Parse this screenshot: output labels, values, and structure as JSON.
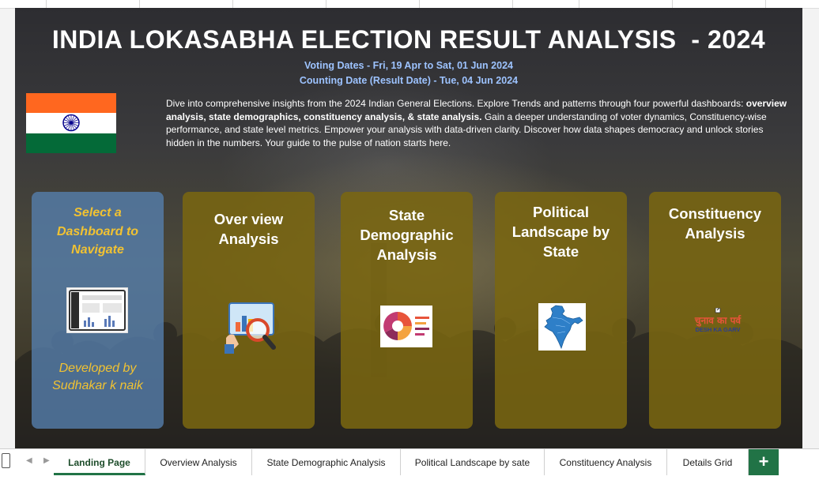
{
  "title": "INDIA LOKASABHA ELECTION RESULT ANALYSIS  - 2024",
  "voting_dates": "Voting Dates - Fri, 19 Apr to Sat, 01 Jun 2024",
  "counting_date": "Counting Date (Result Date) - Tue, 04 Jun 2024",
  "intro": {
    "part1": " Dive into comprehensive insights from the 2024 Indian General Elections. Explore Trends and patterns through four powerful dashboards: ",
    "bold": "overview analysis, state demographics, constituency analysis, & state analysis.",
    "part2": " Gain a deeper understanding of voter dynamics, Constituency-wise performance, and state level metrics. Empower your analysis with data-driven clarity. Discover how data shapes democracy and unlock stories hidden in the numbers. Your guide to the pulse of nation starts here."
  },
  "flag_colors": {
    "saffron": "#ff671f",
    "white": "#ffffff",
    "green": "#046a38",
    "chakra": "#06038d"
  },
  "nav_card": {
    "line1": "Select a",
    "line2": "Dashboard to",
    "line3": "Navigate",
    "dev1": "Developed by",
    "dev2": "Sudhakar k naik"
  },
  "cards": [
    {
      "line1": "Over view",
      "line2": "Analysis",
      "icon": "magnifier-chart-icon"
    },
    {
      "line1": "State",
      "line2": "Demographic",
      "line3": "Analysis",
      "icon": "infographic-icon"
    },
    {
      "line1": "Political",
      "line2": "Landscape by",
      "line3": "State",
      "icon": "india-map-icon"
    },
    {
      "line1": "Constituency",
      "line2": "Analysis",
      "icon": "election-logo-icon"
    }
  ],
  "logo_text": {
    "top": "चुनाव का पर्व",
    "bottom": "DESH KA GARV"
  },
  "sheet_tabs": [
    "Landing Page",
    "Overview Analysis",
    "State Demographic Analysis",
    "Political Landscape by sate",
    "Constituency Analysis",
    "Details Grid"
  ],
  "active_tab": "Landing Page",
  "add_tab": "+"
}
